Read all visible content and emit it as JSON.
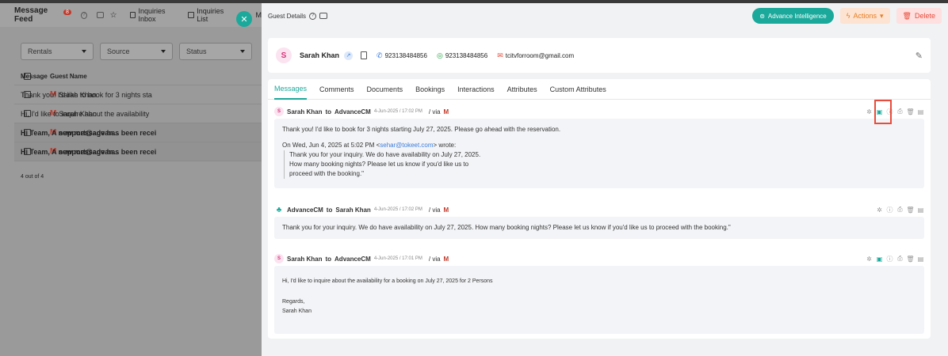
{
  "background": {
    "header": {
      "title": "Message Feed",
      "badge": "8",
      "tabs": [
        "Inquiries Inbox",
        "Inquiries List",
        "M"
      ]
    },
    "filters": [
      "Rentals",
      "Source",
      "Status"
    ],
    "table": {
      "headers": [
        "Guest Name",
        "Message"
      ],
      "rows": [
        {
          "name": "Sarah Khan",
          "message": "Thank you! I'd like to book for 3 nights sta"
        },
        {
          "name": "Sarah Khan",
          "message": "Hi, I'd like to inquire about the availability"
        },
        {
          "name": "support@advan...",
          "message": "Hi Team, A new message has been recei"
        },
        {
          "name": "support@advan...",
          "message": "Hi Team, A new message has been recei"
        }
      ],
      "count": "4 out of 4"
    }
  },
  "panel": {
    "title": "Guest Details",
    "buttons": {
      "ai": "Advance Intelligence",
      "actions": "Actions",
      "delete": "Delete"
    },
    "guest": {
      "initial": "S",
      "name": "Sarah Khan",
      "phone": "923138484856",
      "whatsapp": "923138484856",
      "email": "tcitvforroom@gmail.com"
    },
    "tabs": [
      "Messages",
      "Comments",
      "Documents",
      "Bookings",
      "Interactions",
      "Attributes",
      "Custom Attributes"
    ],
    "messages": [
      {
        "from": "Sarah Khan",
        "to": "AdvanceCM",
        "date": "4-Jun-2025 / 17:02 PM",
        "via": "/ via",
        "body": "Thank you! I'd like to book for 3 nights starting July 27, 2025. Please go ahead with the reservation.",
        "quote_header_pre": "On Wed, Jun 4, 2025 at 5:02 PM <",
        "quote_link": "sehar@tokeet.com",
        "quote_header_post": "> wrote:",
        "quote_lines": [
          "Thank you for your inquiry. We do have availability on July 27, 2025.",
          "How many booking nights? Please let us know if you'd like us to",
          "proceed with the booking.\""
        ]
      },
      {
        "from": "AdvanceCM",
        "to": "Sarah Khan",
        "date": "4-Jun-2025 / 17:02 PM",
        "via": "/ via",
        "body": "Thank you for your inquiry. We do have availability on July 27, 2025. How many booking nights? Please let us know if you'd like us to proceed with the booking.\""
      },
      {
        "from": "Sarah Khan",
        "to": "AdvanceCM",
        "date": "4-Jun-2025 / 17:01 PM",
        "via": "/ via",
        "body": "Hi, I'd like to inquire about the availability for a booking on July 27, 2025 for 2 Persons",
        "regards": "Regards,",
        "signature": "Sarah Khan"
      }
    ],
    "to_word": "to",
    "gmail_icon": "M"
  }
}
